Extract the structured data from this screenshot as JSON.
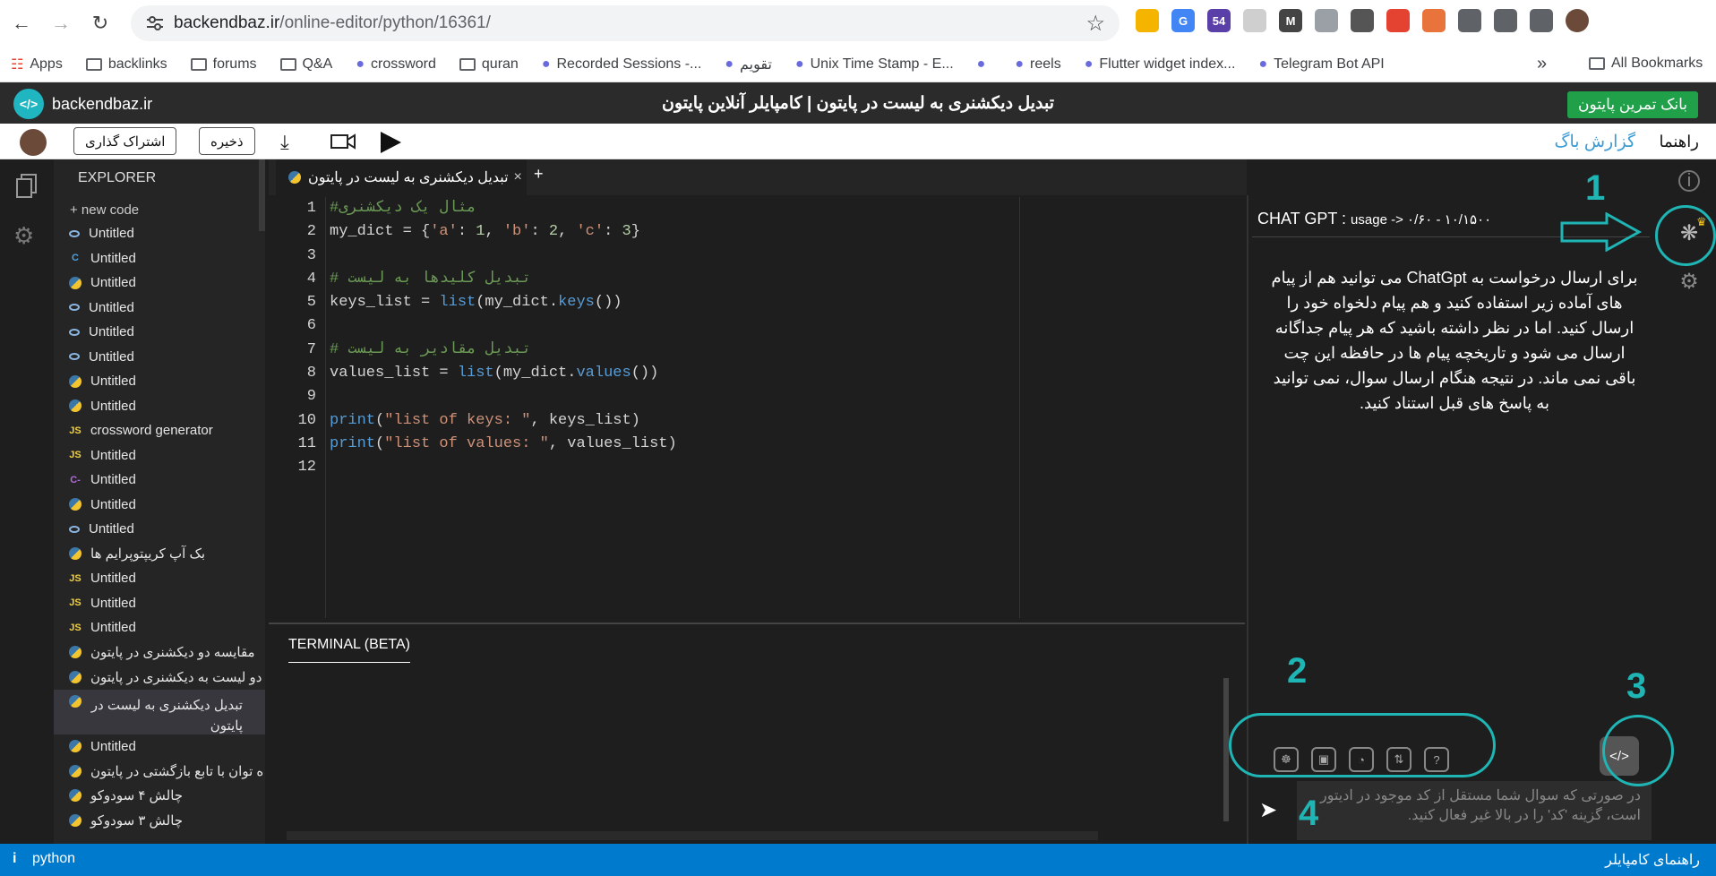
{
  "browser": {
    "url_host": "backendbaz.ir",
    "url_path": "/online-editor/python/16361/",
    "extensions": [
      {
        "icon": "lightning-icon",
        "color": "#f5b400",
        "label": ""
      },
      {
        "icon": "translate-icon",
        "color": "#4285f4",
        "label": "G"
      },
      {
        "icon": "badge-icon",
        "color": "#5b3fa8",
        "label": "54"
      },
      {
        "icon": "moon-icon",
        "color": "#cfcfcf",
        "label": ""
      },
      {
        "icon": "gmail-icon",
        "color": "#444444",
        "label": "M"
      },
      {
        "icon": "shield-icon",
        "color": "#9aa0a6",
        "label": ""
      },
      {
        "icon": "form-icon",
        "color": "#555555",
        "label": ""
      },
      {
        "icon": "todoist-icon",
        "color": "#e44332",
        "label": ""
      },
      {
        "icon": "megaphone-icon",
        "color": "#e8743b",
        "label": ""
      },
      {
        "icon": "puzzle-icon",
        "color": "#5f6368",
        "label": ""
      },
      {
        "icon": "playlist-icon",
        "color": "#5f6368",
        "label": ""
      },
      {
        "icon": "sidepanel-icon",
        "color": "#5f6368",
        "label": ""
      },
      {
        "icon": "profile-avatar",
        "color": "#6b4a3a",
        "label": ""
      }
    ]
  },
  "bookmarks": [
    "Apps",
    "backlinks",
    "forums",
    "Q&A",
    "crossword",
    "quran",
    "Recorded Sessions -...",
    "تقویم",
    "Unix Time Stamp - E...",
    "",
    "reels",
    "Flutter widget index...",
    "Telegram Bot API"
  ],
  "bookmarks_more": "»",
  "all_bookmarks": "All Bookmarks",
  "app": {
    "brand": "backendbaz.ir",
    "title": "تبدیل دیکشنری به لیست در پایتون | کامپایلر آنلاین پایتون",
    "exercise_bank": "بانک تمرین پایتون"
  },
  "toolbar": {
    "share": "اشتراک گذاری",
    "save": "ذخیره",
    "guide": "راهنما",
    "bug_report": "گزارش باگ"
  },
  "explorer": {
    "title": "EXPLORER",
    "new_code": "+ new code",
    "files": [
      {
        "type": "lnk",
        "name": "Untitled"
      },
      {
        "type": "c",
        "name": "Untitled"
      },
      {
        "type": "py",
        "name": "Untitled"
      },
      {
        "type": "lnk",
        "name": "Untitled"
      },
      {
        "type": "lnk",
        "name": "Untitled"
      },
      {
        "type": "lnk",
        "name": "Untitled"
      },
      {
        "type": "py",
        "name": "Untitled"
      },
      {
        "type": "py",
        "name": "Untitled"
      },
      {
        "type": "js",
        "name": "crossword generator"
      },
      {
        "type": "js",
        "name": "Untitled"
      },
      {
        "type": "cm",
        "name": "Untitled"
      },
      {
        "type": "py",
        "name": "Untitled"
      },
      {
        "type": "lnk",
        "name": "Untitled"
      },
      {
        "type": "py",
        "name": "بک آپ کریپتوپرایم ها"
      },
      {
        "type": "js",
        "name": "Untitled"
      },
      {
        "type": "js",
        "name": "Untitled"
      },
      {
        "type": "js",
        "name": "Untitled"
      },
      {
        "type": "py",
        "name": "مقایسه دو دیکشنری در پایتون"
      },
      {
        "type": "py",
        "name": "دو لیست به دیکشنری در پایتون"
      },
      {
        "type": "py",
        "name": "تبدیل دیکشنری به لیست در پایتون",
        "selected": true
      },
      {
        "type": "py",
        "name": "Untitled"
      },
      {
        "type": "py",
        "name": "ه توان با تابع بازگشتی در پایتون"
      },
      {
        "type": "py",
        "name": "چالش ۴ سودوکو"
      },
      {
        "type": "py",
        "name": "چالش ۳ سودوکو"
      }
    ]
  },
  "tab": {
    "label": "تبدیل دیکشنری به لیست در پایتون",
    "close": "×",
    "add": "+"
  },
  "code_lines": [
    [
      {
        "t": "#مثال یک دیکشنری",
        "c": "cmt"
      }
    ],
    [
      {
        "t": "my_dict = {"
      },
      {
        "t": "'a'",
        "c": "str"
      },
      {
        "t": ": "
      },
      {
        "t": "1",
        "c": "num"
      },
      {
        "t": ", "
      },
      {
        "t": "'b'",
        "c": "str"
      },
      {
        "t": ": "
      },
      {
        "t": "2",
        "c": "num"
      },
      {
        "t": ", "
      },
      {
        "t": "'c'",
        "c": "str"
      },
      {
        "t": ": "
      },
      {
        "t": "3",
        "c": "num"
      },
      {
        "t": "}"
      }
    ],
    [],
    [
      {
        "t": "# تبدیل کلیدها به لیست",
        "c": "cmt"
      }
    ],
    [
      {
        "t": "keys_list = "
      },
      {
        "t": "list",
        "c": "fn"
      },
      {
        "t": "(my_dict."
      },
      {
        "t": "keys",
        "c": "fn"
      },
      {
        "t": "())"
      }
    ],
    [],
    [
      {
        "t": "# تبدیل مقادیر به لیست",
        "c": "cmt"
      }
    ],
    [
      {
        "t": "values_list = "
      },
      {
        "t": "list",
        "c": "fn"
      },
      {
        "t": "(my_dict."
      },
      {
        "t": "values",
        "c": "fn"
      },
      {
        "t": "())"
      }
    ],
    [],
    [
      {
        "t": "print",
        "c": "fn"
      },
      {
        "t": "("
      },
      {
        "t": "\"list of keys: \"",
        "c": "str"
      },
      {
        "t": ", keys_list)"
      }
    ],
    [
      {
        "t": "print",
        "c": "fn"
      },
      {
        "t": "("
      },
      {
        "t": "\"list of values: \"",
        "c": "str"
      },
      {
        "t": ", values_list)"
      }
    ],
    []
  ],
  "terminal": {
    "title": "TERMINAL (BETA)"
  },
  "chat": {
    "label": "CHAT GPT :",
    "usage": "usage -> ۰/۶۰ - ۱۰/۱۵۰۰",
    "body": "برای ارسال درخواست به ChatGpt می توانید هم از پیام های آماده زیر استفاده کنید و هم پیام دلخواه خود را ارسال کنید. اما در نظر داشته باشید که هر پیام جداگانه ارسال می شود و تاریخچه پیام ها در حافظه این چت باقی نمی ماند. در نتیجه هنگام ارسال سوال، نمی توانید به پاسخ های قبل استناد کنید.",
    "input_placeholder": "در صورتی که سوال شما مستقل از کد موجود در ادیتور است، گزینه 'کد' را در بالا غیر فعال کنید.",
    "quick_actions": [
      "bug-icon",
      "explain-icon",
      "speed-icon",
      "sort-icon",
      "question-icon"
    ],
    "code_toggle": "</>",
    "send": "➤"
  },
  "annotations": [
    "1",
    "2",
    "3",
    "4"
  ],
  "status": {
    "language": "python",
    "info_icon": "i",
    "compiler_guide": "راهنمای کامپایلر"
  },
  "colors": {
    "accent": "#1fb5b5",
    "status_bar": "#007acc",
    "green_button": "#21a04a"
  }
}
